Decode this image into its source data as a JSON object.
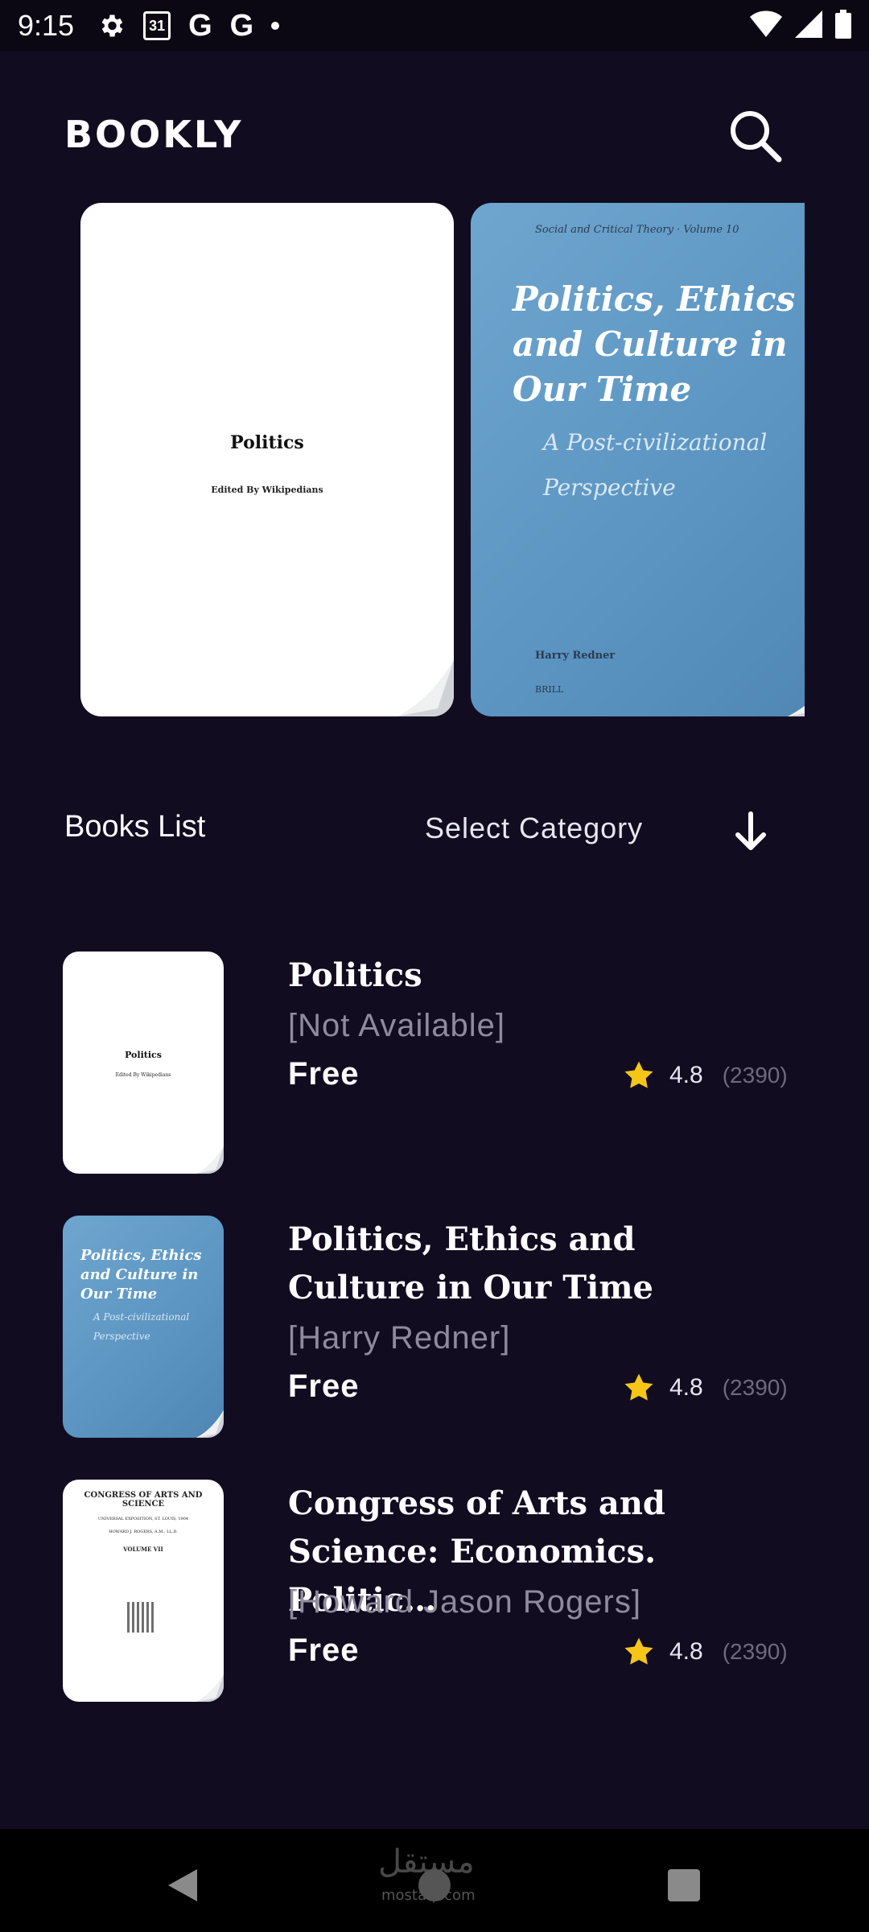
{
  "status_bar": {
    "time": "9:15",
    "calendar_day": "31",
    "google_letter": "G"
  },
  "header": {
    "logo": "BOOKLY",
    "search_icon": "search-icon"
  },
  "carousel": {
    "books": [
      {
        "title": "Politics",
        "subtitle": "Edited By Wikipedians"
      },
      {
        "series": "Social and Critical Theory · Volume 10",
        "title": "Politics, Ethics and Culture in Our Time",
        "subtitle": "A Post-civilizational Perspective",
        "author": "Harry Redner",
        "publisher": "BRILL"
      }
    ]
  },
  "section": {
    "title": "Books List",
    "category_select": "Select Category",
    "arrow_icon": "arrow-down-icon"
  },
  "books": [
    {
      "title": "Politics",
      "author": "[Not Available]",
      "price": "Free",
      "rating": "4.8",
      "reviews": "(2390)",
      "cover_title": "Politics",
      "cover_sub": "Edited By Wikipedians"
    },
    {
      "title": "Politics, Ethics and Culture in Our Time",
      "author": "[Harry Redner]",
      "price": "Free",
      "rating": "4.8",
      "reviews": "(2390)",
      "cover_title": "Politics, Ethics and Culture in Our Time",
      "cover_sub": "A Post-civilizational Perspective"
    },
    {
      "title": "Congress of Arts and Science: Economics. Politic…",
      "author": "[Howard Jason Rogers]",
      "price": "Free",
      "rating": "4.8",
      "reviews": "(2390)",
      "cover_title": "CONGRESS OF ARTS AND SCIENCE",
      "cover_line2": "UNIVERSAL EXPOSITION, ST. LOUIS, 1904",
      "cover_line3": "HOWARD J. ROGERS, A.M., LL.D.",
      "cover_line4": "VOLUME VII"
    }
  ],
  "nav": {
    "watermark": "مستقل",
    "watermark_sub": "mostaql.com"
  },
  "colors": {
    "background": "#120c21",
    "star": "#f5c518",
    "muted_text": "#8f8a9c"
  }
}
